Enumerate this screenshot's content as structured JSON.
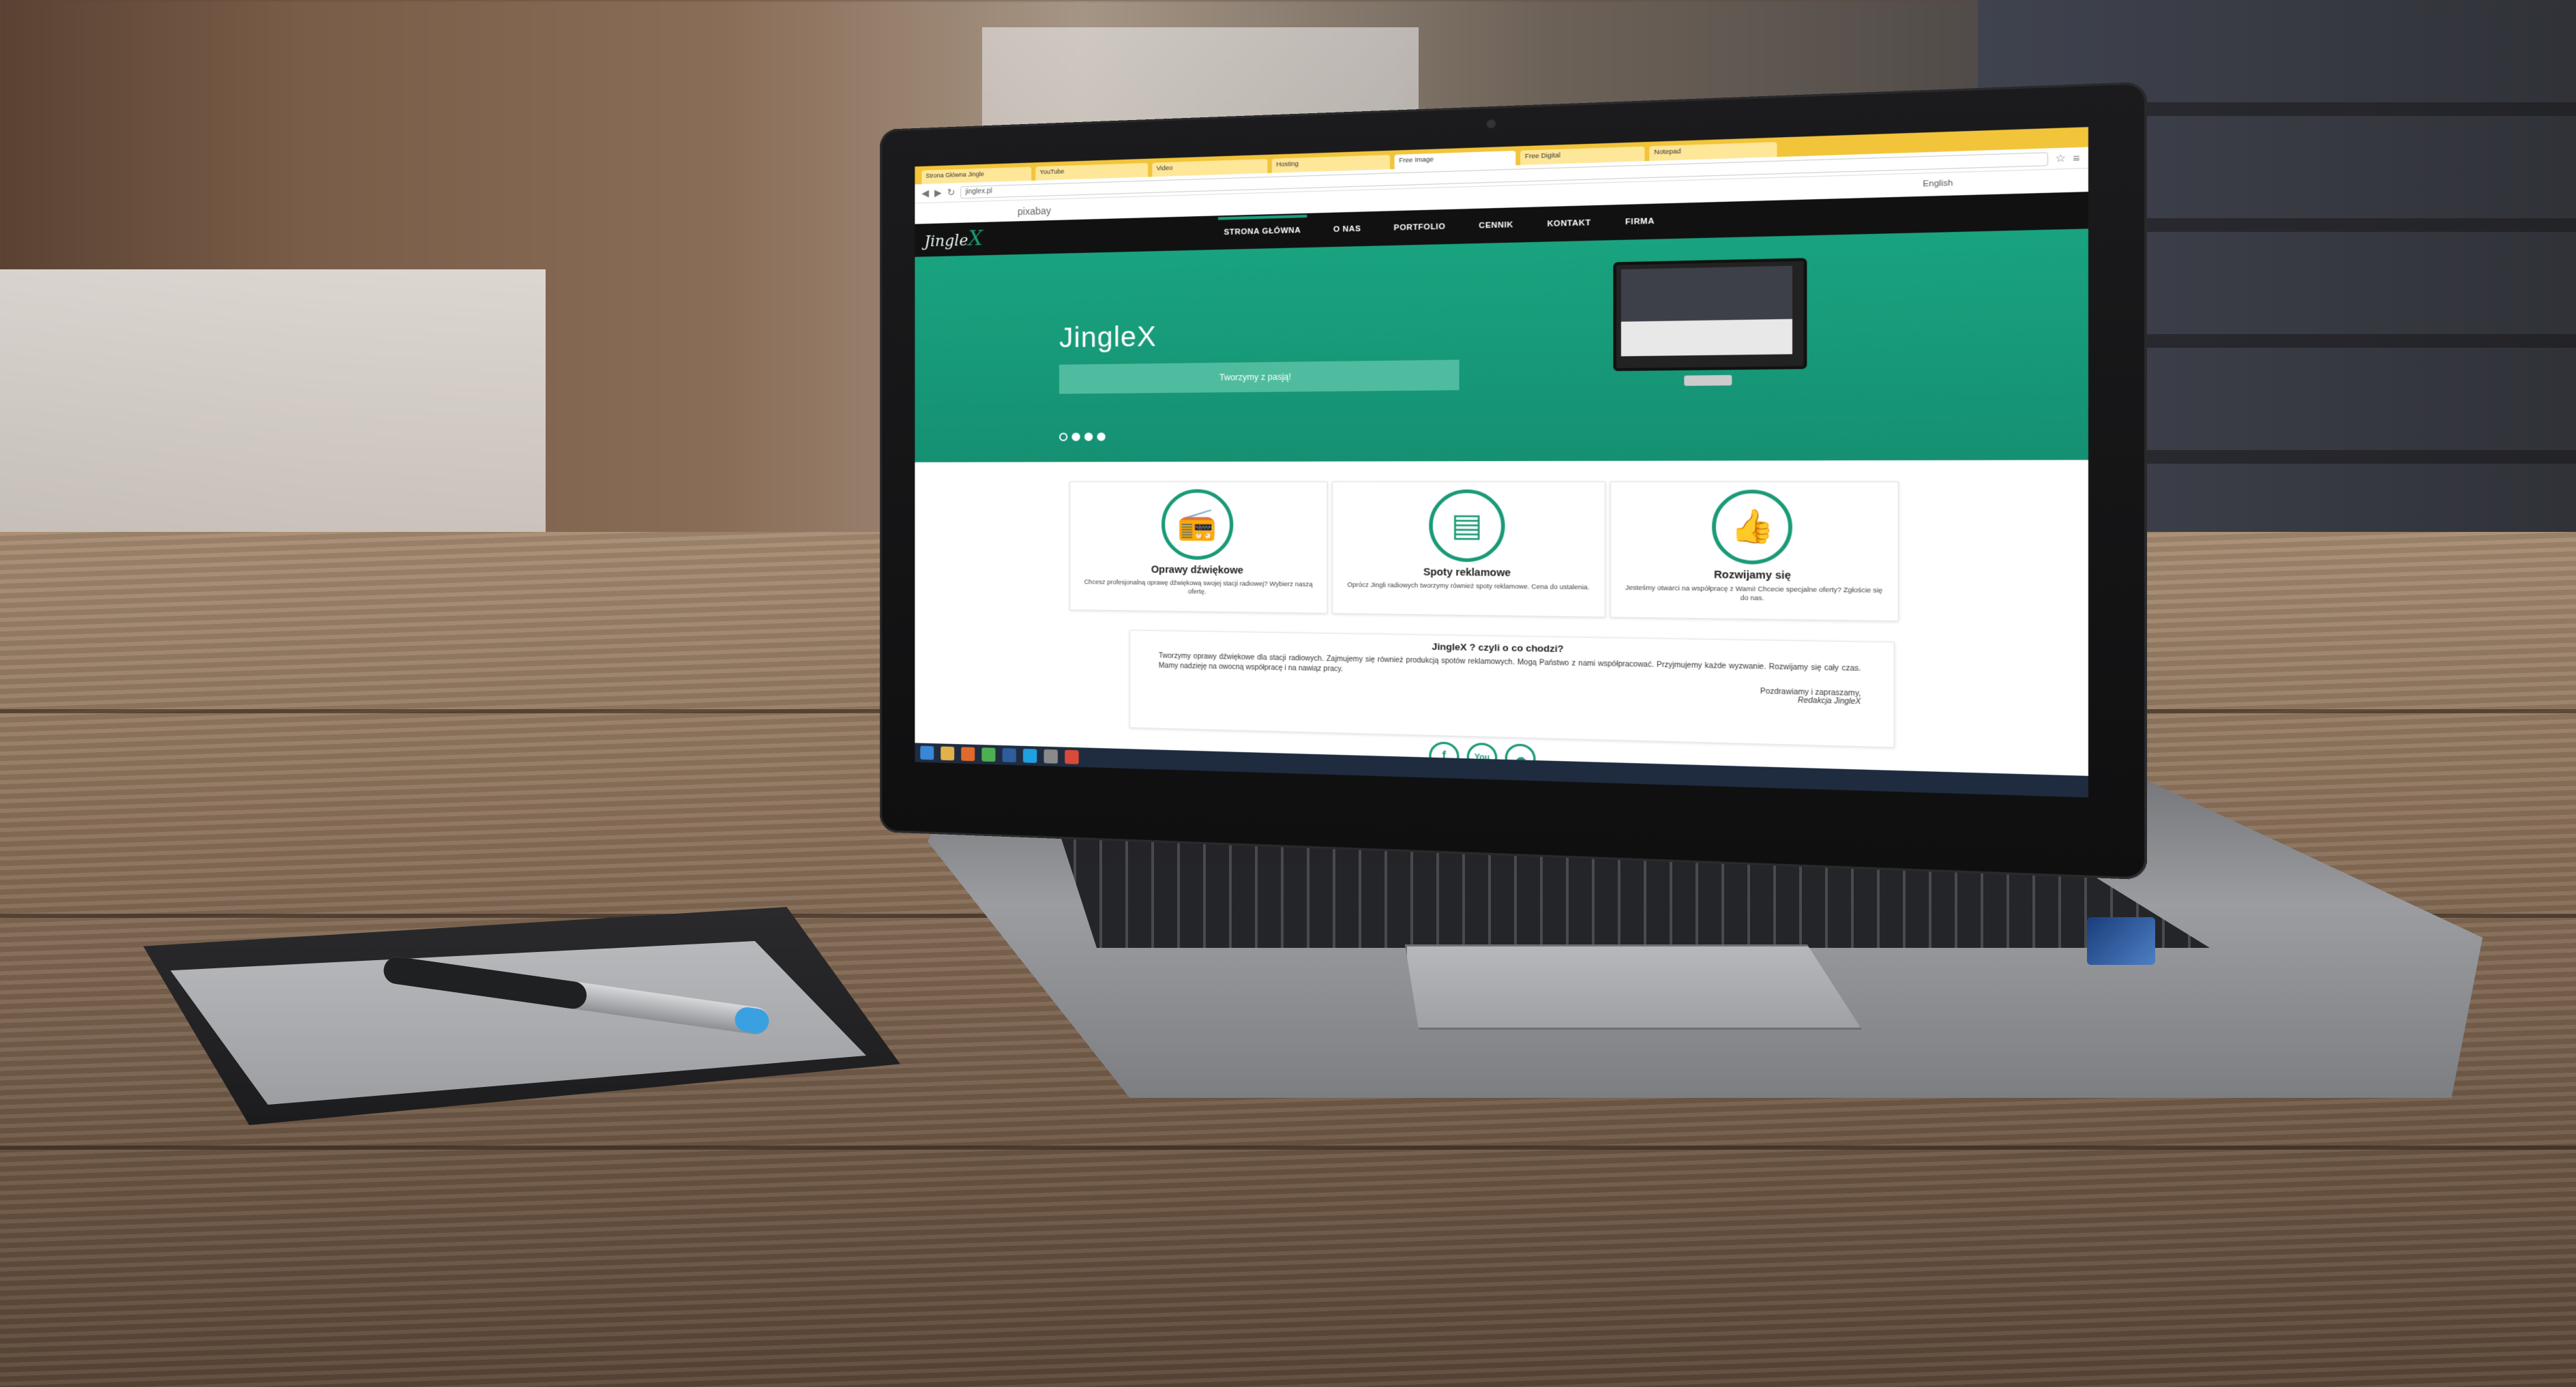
{
  "browser": {
    "tabs": [
      {
        "label": "Strona Główna Jingle"
      },
      {
        "label": "YouTube"
      },
      {
        "label": "Video"
      },
      {
        "label": "Hosting"
      },
      {
        "label": "Free Image"
      },
      {
        "label": "Free Digital"
      },
      {
        "label": "Notepad"
      }
    ],
    "url": "jinglex.pl",
    "bookmark": "pixabay",
    "language": "English"
  },
  "site": {
    "logo": "Jingle",
    "logo_x": "X",
    "nav": [
      {
        "label": "STRONA GŁÓWNA",
        "active": true
      },
      {
        "label": "O NAS",
        "active": false
      },
      {
        "label": "PORTFOLIO",
        "active": false
      },
      {
        "label": "CENNIK",
        "active": false
      },
      {
        "label": "KONTAKT",
        "active": false
      },
      {
        "label": "FIRMA",
        "active": false
      }
    ],
    "hero": {
      "title": "JingleX",
      "tagline": "Tworzymy z pasją!"
    },
    "features": [
      {
        "icon": "radio-icon",
        "title": "Oprawy dźwiękowe",
        "text": "Chcesz profesjonalną oprawę dźwiękową swojej stacji radiowej? Wybierz naszą ofertę."
      },
      {
        "icon": "newspaper-icon",
        "title": "Spoty reklamowe",
        "text": "Oprócz Jingli radiowych tworzymy również spoty reklamowe. Cena do ustalenia."
      },
      {
        "icon": "thumbs-up-icon",
        "title": "Rozwijamy się",
        "text": "Jesteśmy otwarci na współpracę z Wami! Chcecie specjalne oferty? Zgłoście się do nas."
      }
    ],
    "about": {
      "title": "JingleX ? czyli o co chodzi?",
      "text": "Tworzymy oprawy dźwiękowe dla stacji radiowych. Zajmujemy się również produkcją spotów reklamowych. Mogą Państwo z nami współpracować. Przyjmujemy każde wyzwanie. Rozwijamy się cały czas. Mamy nadzieję na owocną współpracę i na nawiąz pracy.",
      "sign_line": "Pozdrawiamy i zapraszamy,",
      "sign_name": "Redakcja JingleX"
    },
    "social": [
      {
        "icon": "facebook-icon",
        "glyph": "f"
      },
      {
        "icon": "youtube-icon",
        "glyph": "You"
      },
      {
        "icon": "soundcloud-icon",
        "glyph": "☁"
      }
    ]
  },
  "colors": {
    "brand_green": "#1a9a78",
    "nav_black": "#111111",
    "browser_yellow": "#f2c43a"
  }
}
